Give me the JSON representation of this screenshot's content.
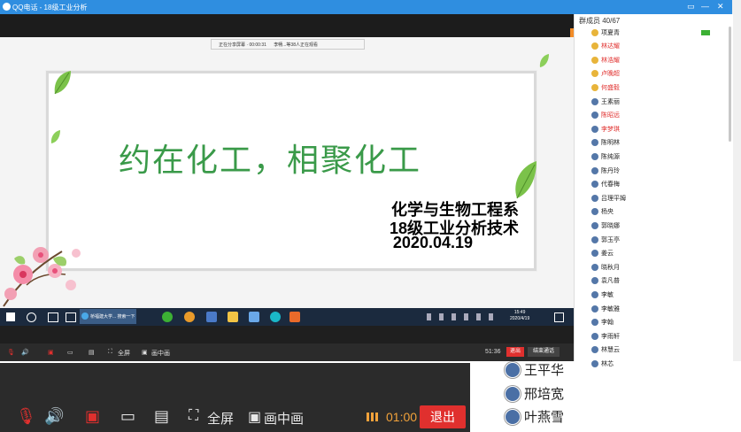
{
  "window": {
    "title": "QQ电话 - 18级工业分析",
    "controls": [
      "▭",
      "—",
      "✕"
    ]
  },
  "share_status": {
    "text": "正在分享屏幕 · 00:00:31      李畅...等38人正在观看"
  },
  "slide": {
    "title": "约在化工，相聚化工",
    "line1": "化学与生物工程系",
    "line2": "18级工业分析技术",
    "line3": "2020.04.19"
  },
  "taskbar": {
    "app_label": "桥福建大学... 搜索一下",
    "clock_time": "15:49",
    "clock_date": "2020/4/19"
  },
  "inner_controls": {
    "fullscreen": "全屏",
    "pip": "画中画",
    "timer": "51:36",
    "exit": "退出",
    "end_call": "结束通话"
  },
  "members": {
    "header": "群成员 40/67",
    "list": [
      {
        "name": "项夏青",
        "color": "#222222"
      },
      {
        "name": "林达耀",
        "color": "#e0302e"
      },
      {
        "name": "林浩耀",
        "color": "#e0302e"
      },
      {
        "name": "卢晚超",
        "color": "#e0302e"
      },
      {
        "name": "何盛毅",
        "color": "#e0302e"
      },
      {
        "name": "王素丽",
        "color": "#222222"
      },
      {
        "name": "陈昭远",
        "color": "#e0302e"
      },
      {
        "name": "李梦琪",
        "color": "#e0302e"
      },
      {
        "name": "陈明林",
        "color": "#222222"
      },
      {
        "name": "陈纯源",
        "color": "#222222"
      },
      {
        "name": "陈丹玲",
        "color": "#222222"
      },
      {
        "name": "代春梅",
        "color": "#222222"
      },
      {
        "name": "吕理平姆",
        "color": "#222222"
      },
      {
        "name": "杨央",
        "color": "#222222"
      },
      {
        "name": "郭晓娜",
        "color": "#222222"
      },
      {
        "name": "郭玉亭",
        "color": "#222222"
      },
      {
        "name": "姜云",
        "color": "#222222"
      },
      {
        "name": "晓秋月",
        "color": "#222222"
      },
      {
        "name": "袁凡普",
        "color": "#222222"
      },
      {
        "name": "李敏",
        "color": "#222222"
      },
      {
        "name": "李敏雅",
        "color": "#222222"
      },
      {
        "name": "李翰",
        "color": "#222222"
      },
      {
        "name": "李雨轩",
        "color": "#222222"
      },
      {
        "name": "林慧云",
        "color": "#222222"
      },
      {
        "name": "林芯",
        "color": "#222222"
      }
    ]
  },
  "outer_controls": {
    "fullscreen": "全屏",
    "pip": "画中画",
    "timer": "01:00",
    "exit": "退出"
  },
  "outer_members": [
    "王平华",
    "邢培宽",
    "叶燕雪"
  ],
  "colors": {
    "title_bar": "#2f8ee0",
    "slide_title": "#3a9a49",
    "exit_red": "#e0302e"
  }
}
